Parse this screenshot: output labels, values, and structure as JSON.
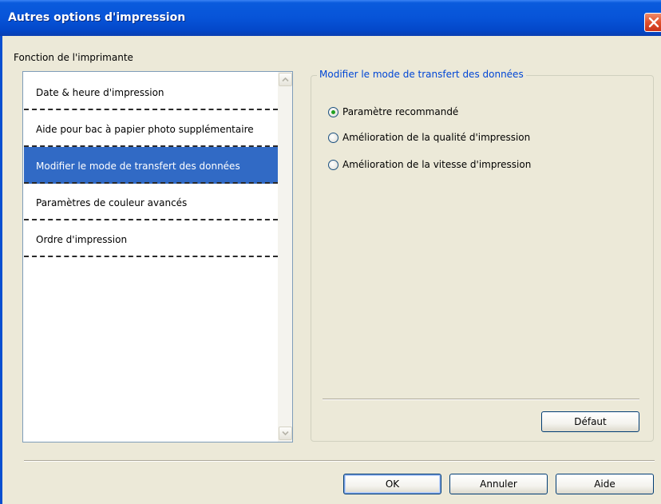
{
  "window": {
    "title": "Autres options d'impression"
  },
  "section_label": "Fonction de l'imprimante",
  "list": {
    "items": [
      {
        "label": "Date & heure d'impression",
        "selected": false
      },
      {
        "label": "Aide pour bac à papier photo supplémentaire",
        "selected": false
      },
      {
        "label": "Modifier le mode de transfert des données",
        "selected": true
      },
      {
        "label": "Paramètres de couleur avancés",
        "selected": false
      },
      {
        "label": "Ordre d'impression",
        "selected": false
      }
    ]
  },
  "group": {
    "legend": "Modifier le mode de transfert des données",
    "options": [
      {
        "label": "Paramètre recommandé",
        "checked": true
      },
      {
        "label": "Amélioration de la qualité d'impression",
        "checked": false
      },
      {
        "label": "Amélioration de la vitesse d'impression",
        "checked": false
      }
    ],
    "default_button": "Défaut"
  },
  "buttons": {
    "ok": "OK",
    "cancel": "Annuler",
    "help": "Aide"
  },
  "icons": {
    "close": "close-icon",
    "scroll_up": "chevron-up-icon",
    "scroll_down": "chevron-down-icon"
  },
  "colors": {
    "titlebar": "#0754d8",
    "selection": "#316ac5",
    "legend": "#0046d5",
    "close": "#e0502c"
  }
}
